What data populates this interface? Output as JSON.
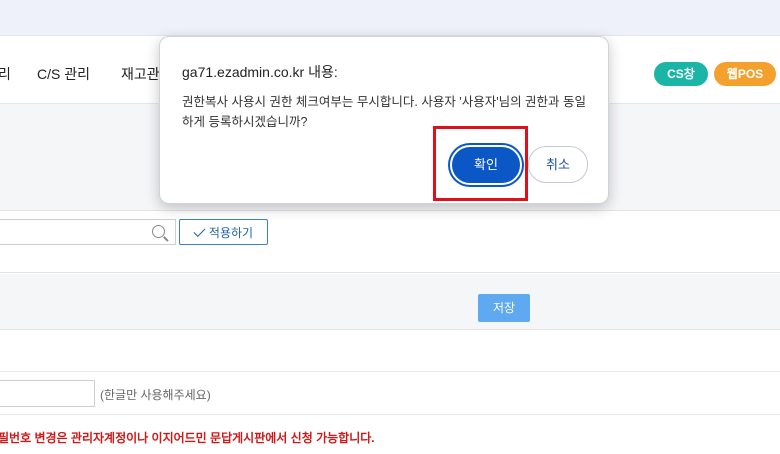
{
  "nav": {
    "items": [
      {
        "label": "리"
      },
      {
        "label": "C/S 관리"
      },
      {
        "label": "재고관"
      }
    ],
    "pills": {
      "cs": {
        "label": "CS창",
        "color": "#1bb5a8"
      },
      "web": {
        "label": "웹POS",
        "color": "#f3a02c"
      }
    }
  },
  "filters": {
    "search": {
      "value": "",
      "icon": "search-icon"
    },
    "apply_label": "적용하기"
  },
  "actions": {
    "save_label": "저장"
  },
  "form": {
    "input_value": "",
    "hint": "(한글만 사용해주세요)",
    "notice": "필번호 변경은 관리자계정이나 이지어드민 문답게시판에서 신청 가능합니다."
  },
  "dialog": {
    "title": "ga71.ezadmin.co.kr 내용:",
    "message": "권한복사 사용시 권한 체크여부는 무시합니다. 사용자 '사용자'님의 권한과 동일하게 등록하시겠습니까?",
    "ok_label": "확인",
    "cancel_label": "취소"
  }
}
